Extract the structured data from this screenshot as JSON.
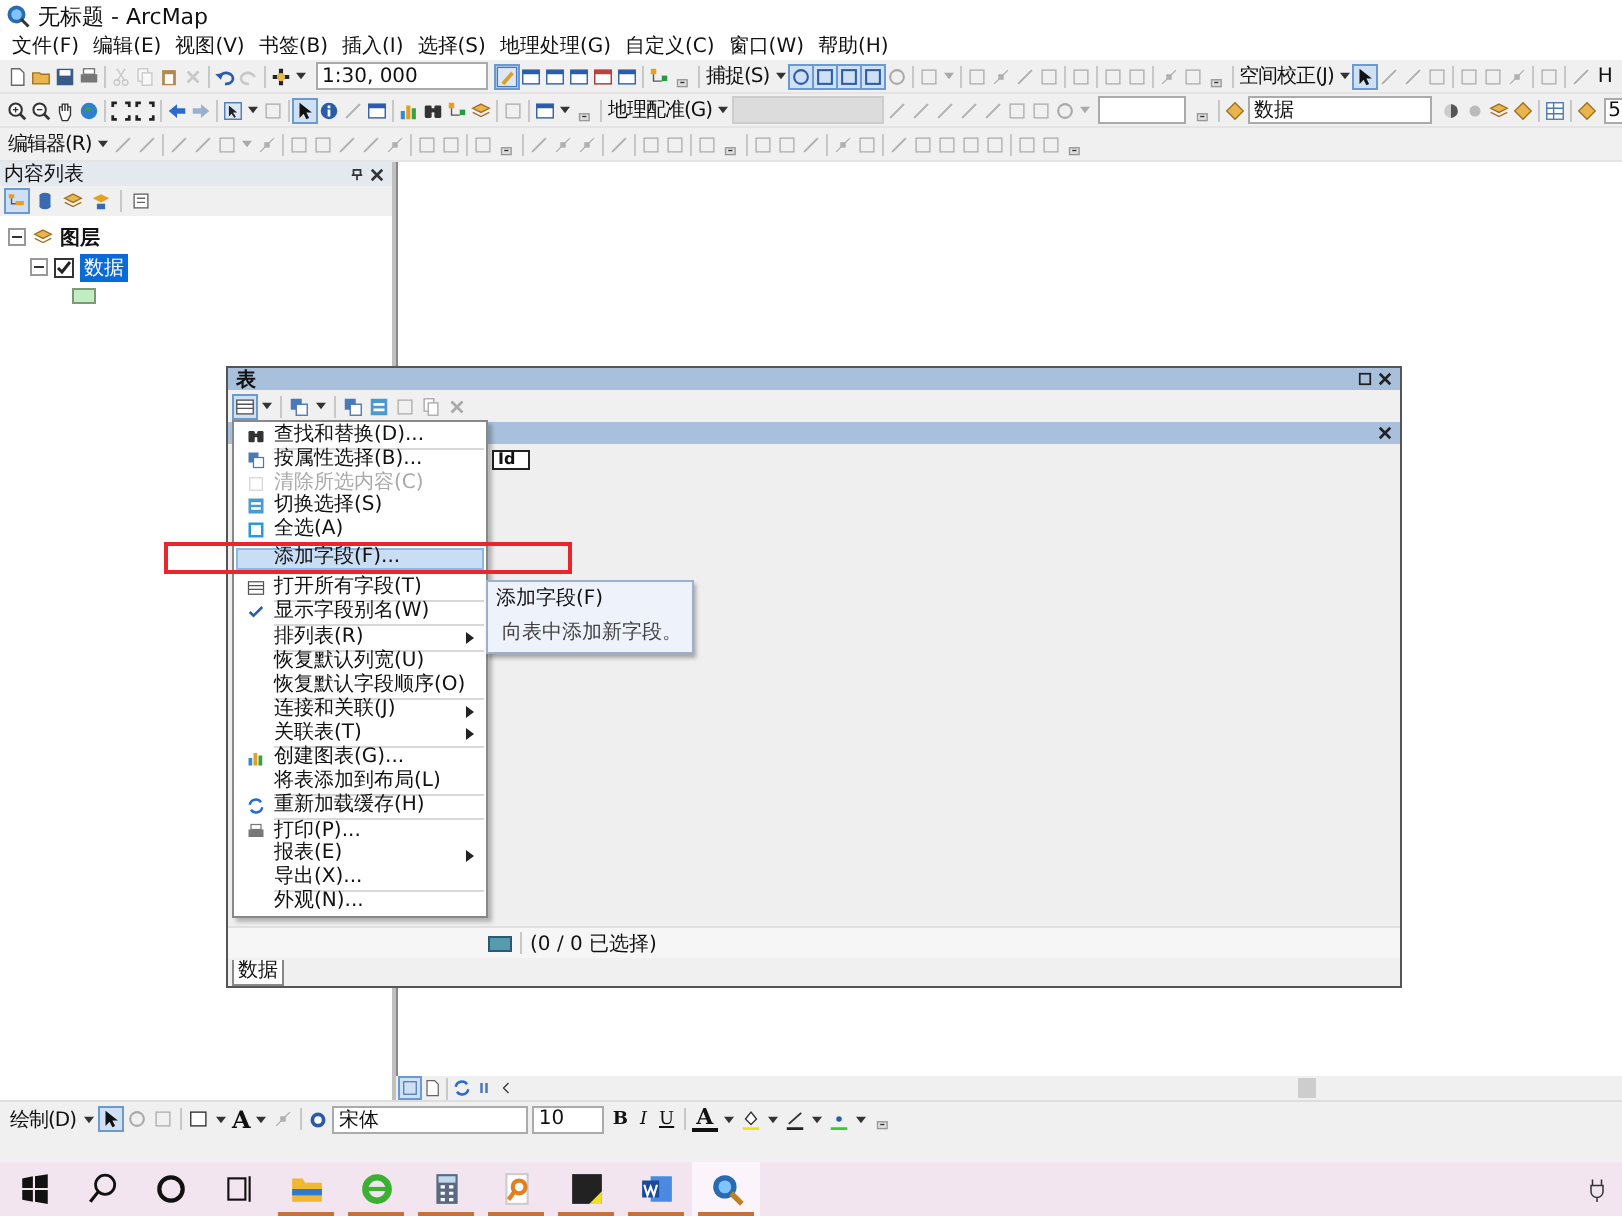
{
  "window": {
    "title": "无标题 - ArcMap"
  },
  "menubar": [
    "文件(F)",
    "编辑(E)",
    "视图(V)",
    "书签(B)",
    "插入(I)",
    "选择(S)",
    "地理处理(G)",
    "自定义(C)",
    "窗口(W)",
    "帮助(H)"
  ],
  "toolbars": {
    "scale": "1:30, 000",
    "snapping": "捕捉(S)",
    "georeferencing": "地理配准(G)",
    "spatial_adjustment": "空间校正(J)",
    "layer_combo": "数据",
    "editor": "编辑器(R)",
    "cut_label_1": "H",
    "cut_label_2": "5"
  },
  "toc": {
    "title": "内容列表",
    "layers": [
      {
        "label": "图层",
        "expanded": true,
        "children": [
          {
            "label": "数据",
            "checked": true,
            "selected": true
          }
        ]
      }
    ]
  },
  "table_window": {
    "title": "表",
    "column_1": "Id",
    "status": "(0 / 0 已选择)",
    "tab": "数据"
  },
  "context_menu": [
    {
      "kind": "item",
      "label": "查找和替换(D)...",
      "disabled": false,
      "selected": false,
      "checked": false,
      "submenu": false
    },
    {
      "kind": "separator"
    },
    {
      "kind": "item",
      "label": "按属性选择(B)...",
      "disabled": false,
      "selected": false,
      "checked": false,
      "submenu": false
    },
    {
      "kind": "item",
      "label": "清除所选内容(C)",
      "disabled": true,
      "selected": false,
      "checked": false,
      "submenu": false
    },
    {
      "kind": "item",
      "label": "切换选择(S)",
      "disabled": false,
      "selected": false,
      "checked": false,
      "submenu": false
    },
    {
      "kind": "item",
      "label": "全选(A)",
      "disabled": false,
      "selected": false,
      "checked": false,
      "submenu": false
    },
    {
      "kind": "item",
      "label": "添加字段(F)...",
      "disabled": false,
      "selected": true,
      "checked": false,
      "submenu": false
    },
    {
      "kind": "item",
      "label": "打开所有字段(T)",
      "disabled": false,
      "selected": false,
      "checked": false,
      "submenu": false
    },
    {
      "kind": "separator"
    },
    {
      "kind": "item",
      "label": "显示字段别名(W)",
      "disabled": false,
      "selected": false,
      "checked": true,
      "submenu": false
    },
    {
      "kind": "separator"
    },
    {
      "kind": "item",
      "label": "排列表(R)",
      "disabled": false,
      "selected": false,
      "checked": false,
      "submenu": true
    },
    {
      "kind": "separator"
    },
    {
      "kind": "item",
      "label": "恢复默认列宽(U)",
      "disabled": false,
      "selected": false,
      "checked": false,
      "submenu": false
    },
    {
      "kind": "item",
      "label": "恢复默认字段顺序(O)",
      "disabled": false,
      "selected": false,
      "checked": false,
      "submenu": false
    },
    {
      "kind": "separator"
    },
    {
      "kind": "item",
      "label": "连接和关联(J)",
      "disabled": false,
      "selected": false,
      "checked": false,
      "submenu": true
    },
    {
      "kind": "item",
      "label": "关联表(T)",
      "disabled": false,
      "selected": false,
      "checked": false,
      "submenu": true
    },
    {
      "kind": "separator"
    },
    {
      "kind": "item",
      "label": "创建图表(G)...",
      "disabled": false,
      "selected": false,
      "checked": false,
      "submenu": false
    },
    {
      "kind": "item",
      "label": "将表添加到布局(L)",
      "disabled": false,
      "selected": false,
      "checked": false,
      "submenu": false
    },
    {
      "kind": "separator"
    },
    {
      "kind": "item",
      "label": "重新加载缓存(H)",
      "disabled": false,
      "selected": false,
      "checked": false,
      "submenu": false
    },
    {
      "kind": "separator"
    },
    {
      "kind": "item",
      "label": "打印(P)...",
      "disabled": false,
      "selected": false,
      "checked": false,
      "submenu": false
    },
    {
      "kind": "item",
      "label": "报表(E)",
      "disabled": false,
      "selected": false,
      "checked": false,
      "submenu": true
    },
    {
      "kind": "item",
      "label": "导出(X)...",
      "disabled": false,
      "selected": false,
      "checked": false,
      "submenu": false
    },
    {
      "kind": "separator"
    },
    {
      "kind": "item",
      "label": "外观(N)...",
      "disabled": false,
      "selected": false,
      "checked": false,
      "submenu": false
    }
  ],
  "tooltip": {
    "title": "添加字段(F)",
    "text": "向表中添加新字段。"
  },
  "draw_toolbar": {
    "label": "绘制(D)",
    "font": "宋体",
    "size": "10",
    "bold": "B",
    "italic": "I",
    "underline": "U",
    "text_tool": "A",
    "text_color": "A"
  },
  "taskbar": [
    {
      "kind": "start",
      "selected": false
    },
    {
      "kind": "search",
      "selected": false
    },
    {
      "kind": "cortana",
      "selected": false
    },
    {
      "kind": "taskview",
      "selected": false
    },
    {
      "kind": "explorer",
      "selected": false
    },
    {
      "kind": "browser",
      "selected": false
    },
    {
      "kind": "calculator",
      "selected": false
    },
    {
      "kind": "finder",
      "selected": false
    },
    {
      "kind": "notes",
      "selected": false
    },
    {
      "kind": "word",
      "selected": false
    },
    {
      "kind": "arcmap",
      "selected": true
    }
  ]
}
